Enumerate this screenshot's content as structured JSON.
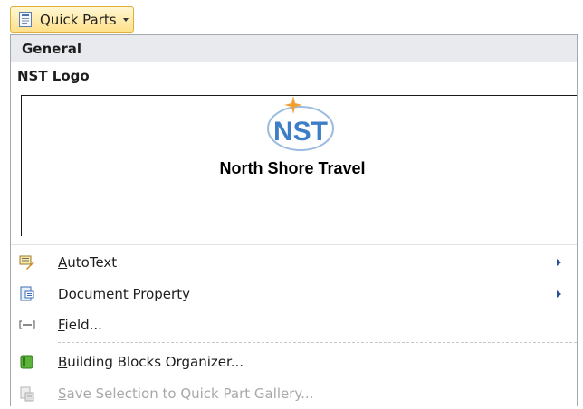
{
  "ribbon": {
    "quick_parts_label": "Quick Parts",
    "quick_parts_icon": "quick-parts-icon"
  },
  "gallery": {
    "category": "General",
    "item_title": "NST Logo",
    "logo_text": "NST",
    "company_name": "North Shore Travel"
  },
  "menu": {
    "items": [
      {
        "label": "AutoText",
        "accel": "A",
        "rest": "utoText",
        "icon": "autotext-icon",
        "submenu": true,
        "enabled": true
      },
      {
        "label": "Document Property",
        "accel": "D",
        "rest": "ocument Property",
        "icon": "document-property-icon",
        "submenu": true,
        "enabled": true
      },
      {
        "label": "Field...",
        "accel": "F",
        "rest": "ield...",
        "icon": "field-icon",
        "submenu": false,
        "enabled": true
      },
      {
        "label": "Building Blocks Organizer...",
        "accel": "B",
        "rest": "uilding Blocks Organizer...",
        "icon": "building-blocks-icon",
        "submenu": false,
        "enabled": true
      },
      {
        "label": "Save Selection to Quick Part Gallery...",
        "accel": "S",
        "rest": "ave Selection to Quick Part Gallery...",
        "icon": "save-selection-icon",
        "submenu": false,
        "enabled": false
      }
    ]
  },
  "colors": {
    "button_bg": "#ffe08a",
    "button_border": "#e0ae3c",
    "logo_blue": "#3d7fc6",
    "logo_star": "#f0a030",
    "disabled_text": "#a8a8a8"
  }
}
